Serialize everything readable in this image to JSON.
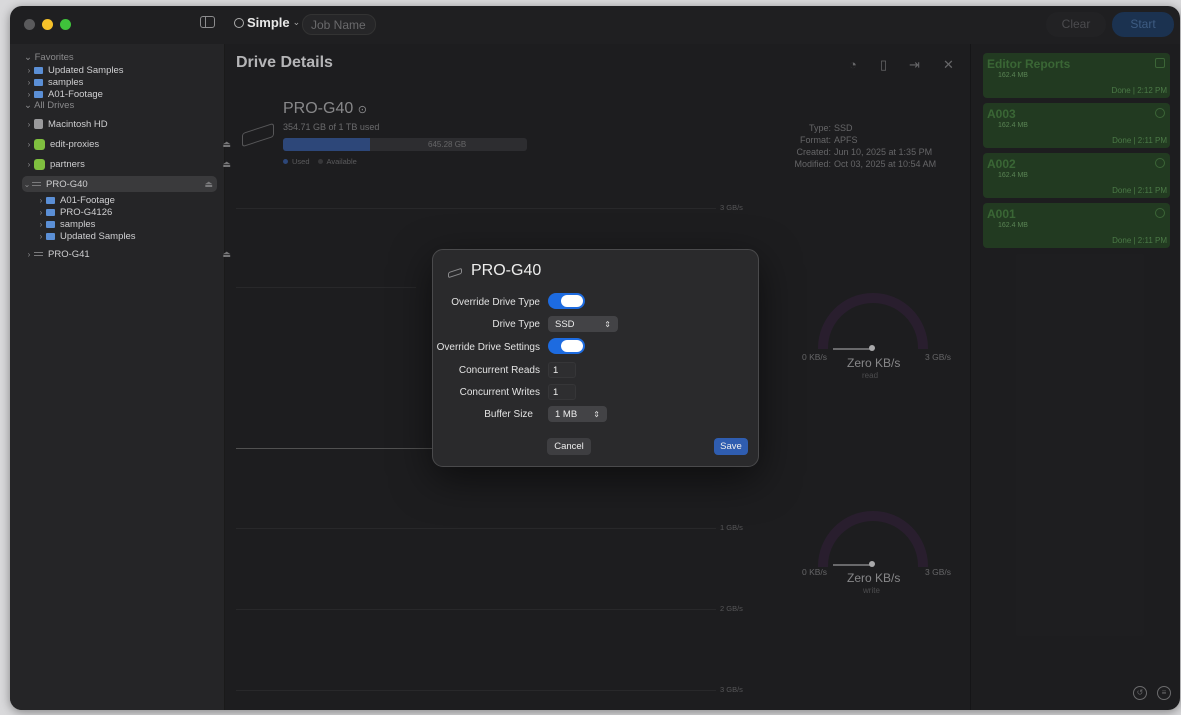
{
  "toolbar": {
    "mode": "Simple",
    "job_name_placeholder": "Job Name",
    "clear": "Clear",
    "start": "Start"
  },
  "sidebar": {
    "favorites_label": "Favorites",
    "favorites": [
      "Updated Samples",
      "samples",
      "A01-Footage"
    ],
    "all_drives_label": "All Drives",
    "drives": [
      {
        "label": "Macintosh HD"
      },
      {
        "label": "edit-proxies"
      },
      {
        "label": "partners"
      },
      {
        "label": "PRO-G40"
      },
      {
        "label": "PRO-G41"
      }
    ],
    "pro_g40_children": [
      "A01-Footage",
      "PRO-G4126",
      "samples",
      "Updated Samples"
    ]
  },
  "details": {
    "title": "Drive Details",
    "drive_name": "PRO-G40",
    "used_text": "354.71 GB of 1 TB used",
    "available_text": "645.28 GB",
    "used_fraction": 0.355,
    "legend_used": "Used",
    "legend_available": "Available",
    "type": "SSD",
    "format": "APFS",
    "created": "Jun 10, 2025 at 1:35 PM",
    "modified": "Oct 03, 2025 at 10:54 AM",
    "labels": {
      "type": "Type:",
      "format": "Format:",
      "created": "Created:",
      "modified": "Modified:"
    },
    "grid": {
      "l1": "3 GB/s",
      "l2": "1 GB/s",
      "l3": "2 GB/s",
      "l4": "3 GB/s"
    },
    "read_gauge": {
      "min": "0 KB/s",
      "max": "3 GB/s",
      "value": "Zero KB/s",
      "sub": "read"
    },
    "write_gauge": {
      "min": "0 KB/s",
      "max": "3 GB/s",
      "value": "Zero KB/s",
      "sub": "write"
    }
  },
  "reports": {
    "title": "Editor Reports",
    "items": [
      {
        "title": "Editor Reports",
        "size": "162.4 MB",
        "status": "Done | 2:12 PM"
      },
      {
        "title": "A003",
        "size": "162.4 MB",
        "status": "Done | 2:11 PM"
      },
      {
        "title": "A002",
        "size": "162.4 MB",
        "status": "Done | 2:11 PM"
      },
      {
        "title": "A001",
        "size": "162.4 MB",
        "status": "Done | 2:11 PM"
      }
    ]
  },
  "modal": {
    "title": "PRO-G40",
    "override_drive_type": "Override Drive Type",
    "drive_type_label": "Drive Type",
    "drive_type_value": "SSD",
    "override_drive_settings": "Override Drive Settings",
    "concurrent_reads_label": "Concurrent Reads",
    "concurrent_reads_value": "1",
    "concurrent_writes_label": "Concurrent Writes",
    "concurrent_writes_value": "1",
    "buffer_size_label": "Buffer Size",
    "buffer_size_value": "1 MB",
    "cancel": "Cancel",
    "save": "Save"
  }
}
